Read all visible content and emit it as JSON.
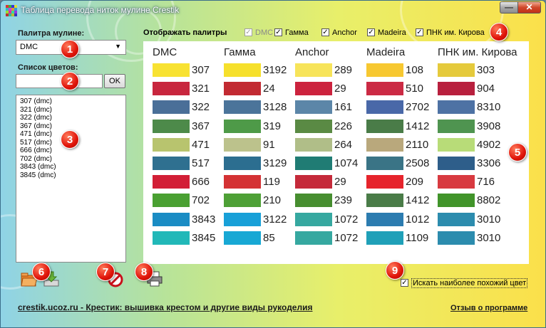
{
  "window": {
    "title": "Таблица перевода ниток мулине Crestik",
    "min_glyph": "—",
    "close_glyph": "✕"
  },
  "left": {
    "palette_label": "Палитра мулине:",
    "palette_value": "DMC",
    "list_label": "Список цветов:",
    "search_value": "",
    "ok_label": "OK",
    "list_items": [
      "307 (dmc)",
      "321 (dmc)",
      "322 (dmc)",
      "367 (dmc)",
      "471 (dmc)",
      "517 (dmc)",
      "666 (dmc)",
      "702 (dmc)",
      "3843 (dmc)",
      "3845 (dmc)"
    ]
  },
  "palettes": {
    "show_label": "Отображать палитры",
    "options": [
      {
        "label": "DMC",
        "checked": true,
        "disabled": true
      },
      {
        "label": "Гамма",
        "checked": true,
        "disabled": false
      },
      {
        "label": "Anchor",
        "checked": true,
        "disabled": false
      },
      {
        "label": "Madeira",
        "checked": true,
        "disabled": false
      },
      {
        "label": "ПНК им. Кирова",
        "checked": true,
        "disabled": false
      }
    ]
  },
  "table": {
    "columns": [
      "DMC",
      "Гамма",
      "Anchor",
      "Madeira",
      "ПНК им. Кирова"
    ],
    "rows": [
      {
        "codes": [
          "307",
          "3192",
          "289",
          "108",
          "303"
        ],
        "colors": [
          "#f8e232",
          "#f6e02c",
          "#f7e45a",
          "#f7c831",
          "#e5ca3c"
        ]
      },
      {
        "codes": [
          "321",
          "24",
          "29",
          "510",
          "904"
        ],
        "colors": [
          "#c8263e",
          "#c22a32",
          "#cc233e",
          "#cb2a44",
          "#b8203e"
        ]
      },
      {
        "codes": [
          "322",
          "3128",
          "161",
          "2702",
          "8310"
        ],
        "colors": [
          "#4a6f98",
          "#4b749a",
          "#5c86a8",
          "#4968a8",
          "#4e72a4"
        ]
      },
      {
        "codes": [
          "367",
          "319",
          "226",
          "1412",
          "3908"
        ],
        "colors": [
          "#4d8a4a",
          "#4e9a48",
          "#5a8a44",
          "#4a7c48",
          "#4f9450"
        ]
      },
      {
        "codes": [
          "471",
          "91",
          "264",
          "2110",
          "4902"
        ],
        "colors": [
          "#b8c46e",
          "#bcc28c",
          "#b0be88",
          "#b9a87c",
          "#b8dc78"
        ]
      },
      {
        "codes": [
          "517",
          "3129",
          "1074",
          "2508",
          "3306"
        ],
        "colors": [
          "#2f7090",
          "#2c6e90",
          "#207c74",
          "#3a7486",
          "#2e5e8a"
        ]
      },
      {
        "codes": [
          "666",
          "119",
          "29",
          "209",
          "716"
        ],
        "colors": [
          "#d21f36",
          "#d43234",
          "#c52a3a",
          "#e6242c",
          "#d83a40"
        ]
      },
      {
        "codes": [
          "702",
          "210",
          "239",
          "1412",
          "8802"
        ],
        "colors": [
          "#4aa032",
          "#4ea036",
          "#478e30",
          "#4a7c48",
          "#41942a"
        ]
      },
      {
        "codes": [
          "3843",
          "3122",
          "1072",
          "1012",
          "3010"
        ],
        "colors": [
          "#1a8cc4",
          "#18a0d8",
          "#36a8a0",
          "#2c7cb0",
          "#2c8cae"
        ]
      },
      {
        "codes": [
          "3845",
          "85",
          "1072",
          "1109",
          "3010"
        ],
        "colors": [
          "#22b8b8",
          "#18a8d4",
          "#36a8a0",
          "#20a0b8",
          "#2c8cae"
        ]
      }
    ]
  },
  "toolbar": {
    "open_icon": "folder-open-icon",
    "save_icon": "save-download-icon",
    "clear_icon": "clear-forbidden-icon",
    "print_icon": "printer-icon"
  },
  "similar": {
    "label": "Искать наиболее похожий цвет",
    "checked": true
  },
  "footer": {
    "link": "crestik.ucoz.ru - Крестик: вышивка крестом и другие виды рукоделия",
    "about": "Отзыв о программе"
  },
  "markers": [
    "1",
    "2",
    "3",
    "4",
    "5",
    "6",
    "7",
    "8",
    "9"
  ],
  "colors": {
    "accent_red": "#e0140a",
    "panel_bg": "#ffffff"
  }
}
